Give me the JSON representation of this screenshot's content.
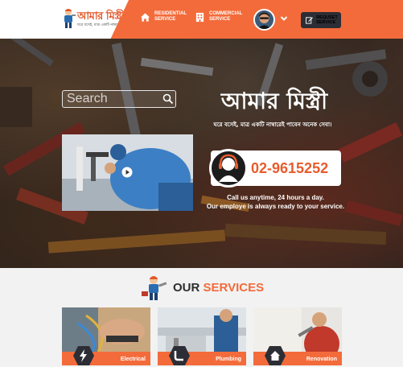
{
  "brand": {
    "logo_title": "আমার মিস্ত্রী",
    "logo_tagline": "ঘরে বসেই, মাত্র একটি নাম্বারেই"
  },
  "nav": {
    "items": [
      {
        "icon": "home-icon",
        "label": "RESIDENTIAL SERVICE"
      },
      {
        "icon": "building-icon",
        "label": "COMMERCIAL SERVICE"
      }
    ],
    "request_label": "REQUSET SERVICE",
    "request_icon": "edit-icon"
  },
  "hero": {
    "search_placeholder": "Search",
    "title": "আমার মিস্ত্রী",
    "subtitle": "ঘরে বসেই, মাত্র একটি নাম্বারেই পাবেন অনেক সেবা।",
    "phone": "02-9615252",
    "call_line1": "Call us anytime, 24 hours a day.",
    "call_line2": "Our employe is always ready to your service."
  },
  "services": {
    "title_main": "OUR ",
    "title_accent": "SERVICES",
    "cards": [
      {
        "label": "Electrical",
        "icon": "lightning-icon"
      },
      {
        "label": "Plumbing",
        "icon": "pipe-icon"
      },
      {
        "label": "Renovation",
        "icon": "house-icon"
      }
    ]
  },
  "colors": {
    "accent": "#f36b3a",
    "dark": "#2d2d35",
    "page_bg": "#f2f2f2"
  }
}
